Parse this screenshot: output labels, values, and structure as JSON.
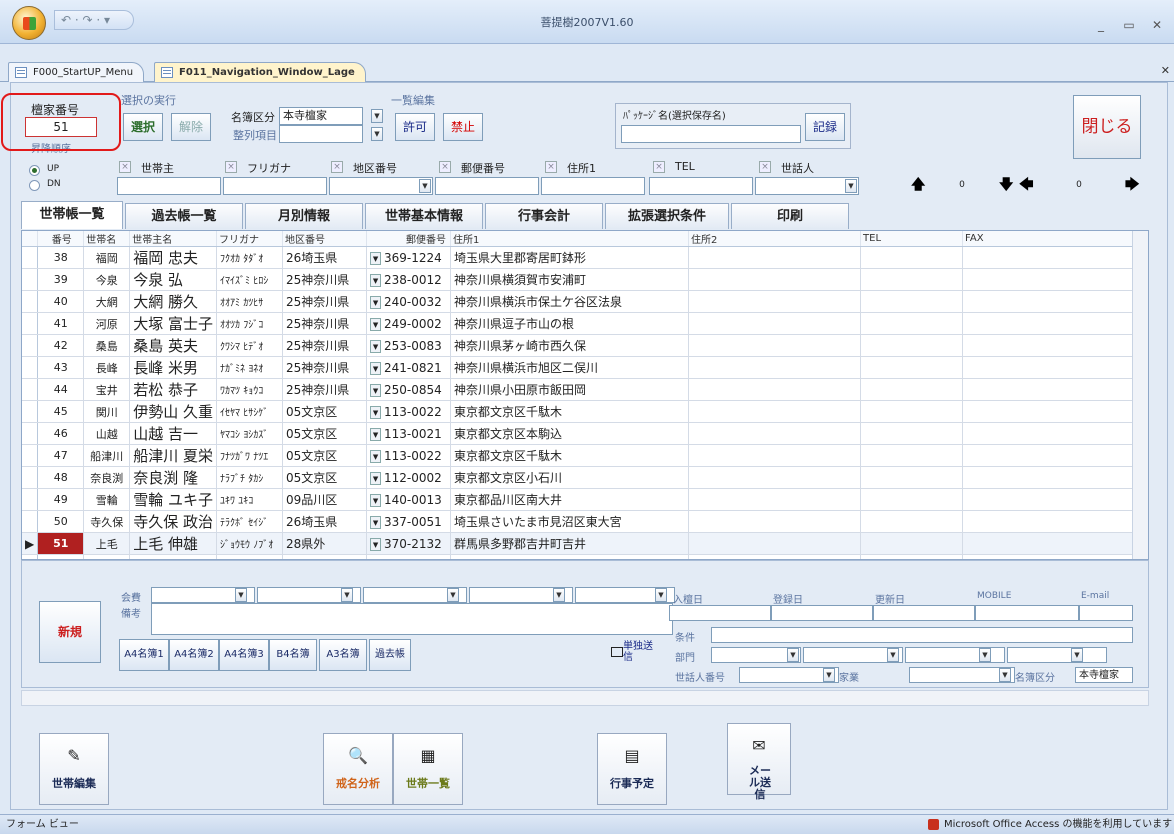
{
  "app_title": "菩提樹2007V1.60",
  "qat_icons": "↶ · ↷ · ▾",
  "doc_tabs": [
    "F000_StartUP_Menu",
    "F011_Navigation_Window_Lage"
  ],
  "header": {
    "family_no_label": "檀家番号",
    "family_no_value": "51",
    "sort_order_label": "昇降順序",
    "execute_label": "選択の実行",
    "select_btn": "選択",
    "cancel_btn": "解除",
    "registry_type_label": "名簿区分",
    "registry_type_value": "本寺檀家",
    "sort_item_label": "整列項目",
    "bulk_edit_label": "一覧編集",
    "allow_btn": "許可",
    "deny_btn": "禁止",
    "package_label": "ﾊﾟｯｹｰｼﾞ名(選択保存名)",
    "record_btn": "記録",
    "close_btn": "閉じる",
    "radio_up": "UP",
    "radio_dn": "DN"
  },
  "filters": [
    "世帯主",
    "フリガナ",
    "地区番号",
    "郵便番号",
    "住所1",
    "TEL",
    "世話人"
  ],
  "nav": {
    "left_value": "0",
    "right_value": "0"
  },
  "tabs": [
    "世帯帳一覧",
    "過去帳一覧",
    "月別情報",
    "世帯基本情報",
    "行事会計",
    "拡張選択条件",
    "印刷"
  ],
  "grid": {
    "columns": [
      "番号",
      "世帯名",
      "世帯主名",
      "フリガナ",
      "地区番号",
      "郵便番号",
      "住所1",
      "住所2",
      "TEL",
      "FAX"
    ],
    "rows": [
      [
        "38",
        "福岡",
        "福岡 忠夫",
        "ﾌｸｵｶ ﾀﾀﾞｵ",
        "26埼玉県",
        "369-1224",
        "埼玉県大里郡寄居町鉢形"
      ],
      [
        "39",
        "今泉",
        "今泉 弘",
        "ｲﾏｲｽﾞﾐ ﾋﾛｼ",
        "25神奈川県",
        "238-0012",
        "神奈川県横須賀市安浦町"
      ],
      [
        "40",
        "大網",
        "大網 勝久",
        "ｵｵｱﾐ ｶﾂﾋｻ",
        "25神奈川県",
        "240-0032",
        "神奈川県横浜市保土ケ谷区法泉"
      ],
      [
        "41",
        "河原",
        "大塚 富士子",
        "ｵｵﾂｶ ﾌｼﾞｺ",
        "25神奈川県",
        "249-0002",
        "神奈川県逗子市山の根"
      ],
      [
        "42",
        "桑島",
        "桑島 英夫",
        "ｸﾜｼﾏ ﾋﾃﾞｵ",
        "25神奈川県",
        "253-0083",
        "神奈川県茅ヶ崎市西久保"
      ],
      [
        "43",
        "長峰",
        "長峰 米男",
        "ﾅｶﾞﾐﾈ ﾖﾈｵ",
        "25神奈川県",
        "241-0821",
        "神奈川県横浜市旭区二俣川"
      ],
      [
        "44",
        "宝井",
        "若松 恭子",
        "ﾜｶﾏﾂ ｷｮｳｺ",
        "25神奈川県",
        "250-0854",
        "神奈川県小田原市飯田岡"
      ],
      [
        "45",
        "関川",
        "伊勢山 久重",
        "ｲｾﾔﾏ ﾋｻｼｹﾞ",
        "05文京区",
        "113-0022",
        "東京都文京区千駄木"
      ],
      [
        "46",
        "山越",
        "山越 吉一",
        "ﾔﾏｺｼ ﾖｼｶｽﾞ",
        "05文京区",
        "113-0021",
        "東京都文京区本駒込"
      ],
      [
        "47",
        "船津川",
        "船津川 夏栄",
        "ﾌﾅﾂｶﾞﾜ ﾅﾂｴ",
        "05文京区",
        "113-0022",
        "東京都文京区千駄木"
      ],
      [
        "48",
        "奈良渕",
        "奈良渕 隆",
        "ﾅﾗﾌﾞﾁ ﾀｶｼ",
        "05文京区",
        "112-0002",
        "東京都文京区小石川"
      ],
      [
        "49",
        "雪輪",
        "雪輪 ユキ子",
        "ﾕｷﾜ ﾕｷｺ",
        "09品川区",
        "140-0013",
        "東京都品川区南大井"
      ],
      [
        "50",
        "寺久保",
        "寺久保 政治",
        "ﾃﾗｸﾎﾞ ｾｲｼﾞ",
        "26埼玉県",
        "337-0051",
        "埼玉県さいたま市見沼区東大宮"
      ],
      [
        "51",
        "上毛",
        "上毛 伸雄",
        "ｼﾞｮｳﾓｳ ﾉﾌﾞｵ",
        "28県外",
        "370-2132",
        "群馬県多野郡吉井町吉井"
      ]
    ]
  },
  "lower": {
    "fee_label": "会費",
    "note_label": "備考",
    "new_btn": "新規",
    "list_btns": [
      "A4名簿1",
      "A4名簿2",
      "A4名簿3",
      "B4名簿",
      "A3名簿",
      "過去帳"
    ],
    "single_send": "単独送信",
    "right_headers": [
      "入檀日",
      "登録日",
      "更新日",
      "MOBILE",
      "E-mail"
    ],
    "condition_label": "条件",
    "dept_label": "部門",
    "caretaker_label": "世話人番号",
    "family_business_label": "家業",
    "registry_type_label": "名簿区分",
    "registry_type_value": "本寺檀家"
  },
  "bottom_buttons": [
    {
      "icon": "✎",
      "label": "世帯編集"
    },
    {
      "icon": "🔍",
      "label": "戒名分析"
    },
    {
      "icon": "▦",
      "label": "世帯一覧"
    },
    {
      "icon": "▤",
      "label": "行事予定"
    },
    {
      "icon": "✉",
      "label": "メール送信"
    }
  ],
  "status": {
    "left": "フォーム ビュー",
    "right": "Microsoft Office Access の機能を利用しています"
  },
  "colors": {
    "highlight": "#e21a1a",
    "close_btn": "#cc1f1f",
    "deny_text": "#d40000",
    "current_row": "#b02020"
  }
}
